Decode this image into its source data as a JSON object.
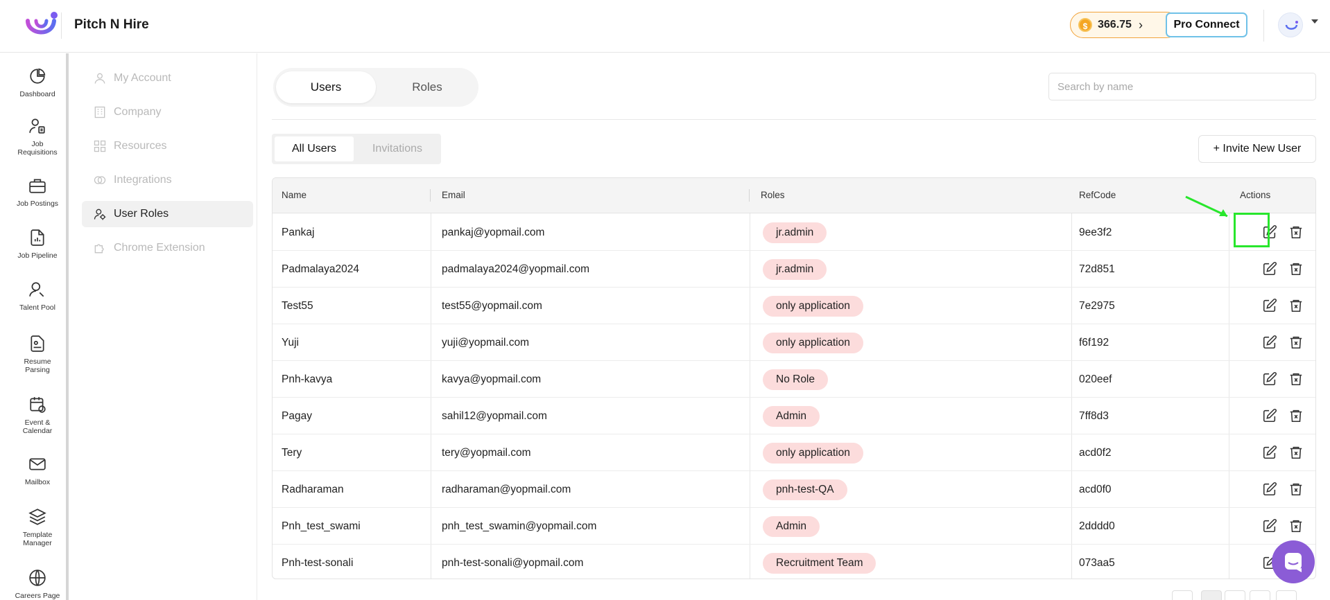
{
  "app": {
    "title": "Pitch N Hire"
  },
  "header": {
    "credits": "366.75",
    "pro_connect": "Pro Connect"
  },
  "nav": [
    {
      "label": "Dashboard",
      "icon": "pie-chart-icon"
    },
    {
      "label": "Job Requisitions",
      "icon": "user-document-icon"
    },
    {
      "label": "Job Postings",
      "icon": "briefcase-icon"
    },
    {
      "label": "Job Pipeline",
      "icon": "file-chart-icon"
    },
    {
      "label": "Talent Pool",
      "icon": "user-search-icon"
    },
    {
      "label": "Resume Parsing",
      "icon": "resume-icon"
    },
    {
      "label": "Event & Calendar",
      "icon": "calendar-icon"
    },
    {
      "label": "Mailbox",
      "icon": "mail-icon"
    },
    {
      "label": "Template Manager",
      "icon": "layers-icon"
    },
    {
      "label": "Careers Page",
      "icon": "globe-icon"
    }
  ],
  "settings_menu": [
    {
      "label": "My Account",
      "icon": "user-icon"
    },
    {
      "label": "Company",
      "icon": "building-icon"
    },
    {
      "label": "Resources",
      "icon": "grid-icon"
    },
    {
      "label": "Integrations",
      "icon": "link-icon"
    },
    {
      "label": "User Roles",
      "icon": "user-gear-icon"
    },
    {
      "label": "Chrome Extension",
      "icon": "puzzle-icon"
    }
  ],
  "tabs": {
    "users": "Users",
    "roles": "Roles"
  },
  "search": {
    "placeholder": "Search by name"
  },
  "subtabs": {
    "all_users": "All Users",
    "invitations": "Invitations"
  },
  "invite_button": "+ Invite New User",
  "table": {
    "columns": {
      "name": "Name",
      "email": "Email",
      "roles": "Roles",
      "refcode": "RefCode",
      "actions": "Actions"
    },
    "rows": [
      {
        "name": "Pankaj",
        "email": "pankaj@yopmail.com",
        "role": "jr.admin",
        "refcode": "9ee3f2"
      },
      {
        "name": "Padmalaya2024",
        "email": "padmalaya2024@yopmail.com",
        "role": "jr.admin",
        "refcode": "72d851"
      },
      {
        "name": "Test55",
        "email": "test55@yopmail.com",
        "role": "only application",
        "refcode": "7e2975"
      },
      {
        "name": "Yuji",
        "email": "yuji@yopmail.com",
        "role": "only application",
        "refcode": "f6f192"
      },
      {
        "name": "Pnh-kavya",
        "email": "kavya@yopmail.com",
        "role": "No Role",
        "refcode": "020eef"
      },
      {
        "name": "Pagay",
        "email": "sahil12@yopmail.com",
        "role": "Admin",
        "refcode": "7ff8d3"
      },
      {
        "name": "Tery",
        "email": "tery@yopmail.com",
        "role": "only application",
        "refcode": "acd0f2"
      },
      {
        "name": "Radharaman",
        "email": "radharaman@yopmail.com",
        "role": "pnh-test-QA",
        "refcode": "acd0f0"
      },
      {
        "name": "Pnh_test_swami",
        "email": "pnh_test_swamin@yopmail.com",
        "role": "Admin",
        "refcode": "2dddd0"
      },
      {
        "name": "Pnh-test-sonali",
        "email": "pnh-test-sonali@yopmail.com",
        "role": "Recruitment Team",
        "refcode": "073aa5"
      }
    ]
  },
  "colors": {
    "badge": "#fcdcdc",
    "highlight": "#28e62c",
    "accent": "#8b5cd6",
    "credits_border": "#f2a33a"
  }
}
